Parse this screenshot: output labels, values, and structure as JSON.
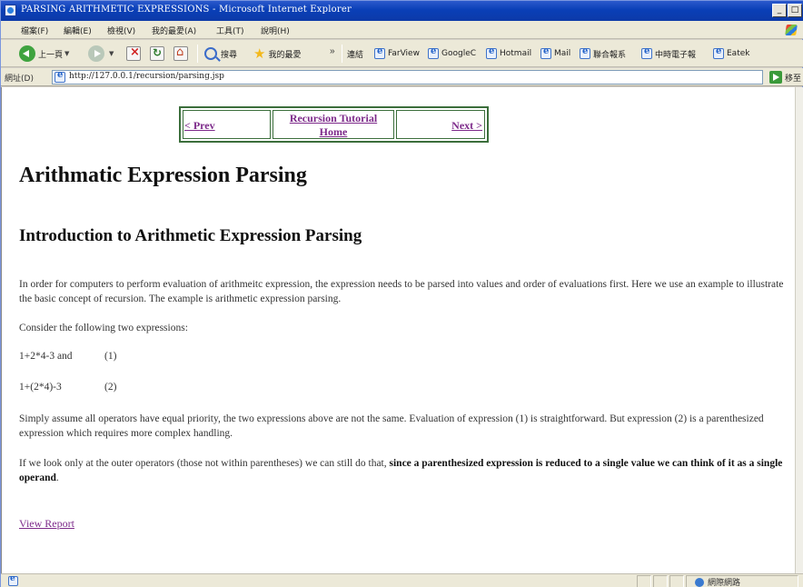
{
  "window": {
    "title": "PARSING ARITHMETIC EXPRESSIONS - Microsoft Internet Explorer",
    "minimize": "_",
    "maximize": "□"
  },
  "menu": [
    "檔案(F)",
    "編輯(E)",
    "檢視(V)",
    "我的最愛(A)",
    "工具(T)",
    "說明(H)"
  ],
  "toolbar": {
    "back_label": "上一頁",
    "search_label": "搜尋",
    "favorites_label": "我的最愛",
    "links_label": "連結",
    "links": [
      "FarView",
      "GoogleC",
      "Hotmail",
      "Mail",
      "聯合報系",
      "中時電子報",
      "Eatek"
    ],
    "more": "»"
  },
  "address": {
    "label": "網址(D)",
    "url": "http://127.0.0.1/recursion/parsing.jsp",
    "go_label": "移至"
  },
  "nav": {
    "prev": "< Prev",
    "home_line1": "Recursion Tutorial",
    "home_line2": "Home",
    "next": "Next >"
  },
  "content": {
    "h1": "Arithmatic Expression Parsing",
    "h2": "Introduction to Arithmetic Expression Parsing",
    "p1": "In order for computers to perform evaluation of arithmeitc expression, the expression needs to be parsed into values and order of evaluations first. Here we use an example to illustrate the basic concept of recursion. The example is arithmetic expression parsing.",
    "p2": "Consider the following two expressions:",
    "expr1": "1+2*4-3 and",
    "expr1_num": "(1)",
    "expr2": "1+(2*4)-3",
    "expr2_num": "(2)",
    "p3": "Simply assume all operators have equal priority, the two expressions above are not the same. Evaluation of expression (1) is straightforward. But expression (2) is a parenthesized expression which requires more complex handling.",
    "p4_a": "If we look only at the outer operators (those not within parentheses) we can still do that, ",
    "p4_bold": "since a parenthesized expression is reduced to a single value we can think of it as a single operand",
    "p4_end": ".",
    "report_link": "View Report"
  },
  "status": {
    "zone": "網際網路"
  }
}
